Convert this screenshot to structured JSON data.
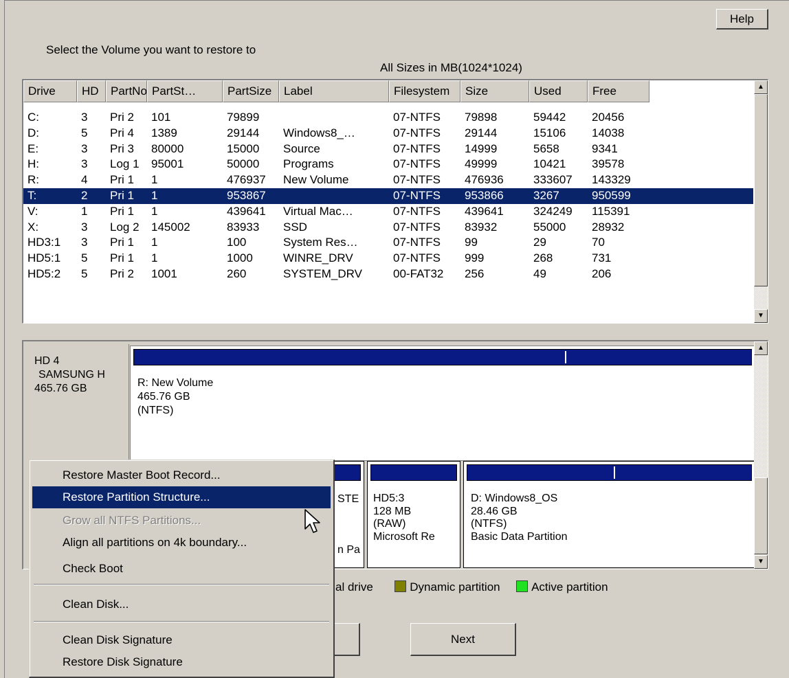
{
  "help_button": "Help",
  "instruction": "Select the Volume you want to restore to",
  "sizes_note": "All Sizes in MB(1024*1024)",
  "columns": [
    "Drive",
    "HD",
    "PartNo",
    "PartSt…",
    "PartSize",
    "Label",
    "Filesystem",
    "Size",
    "Used",
    "Free"
  ],
  "rows": [
    [
      "C:",
      "3",
      "Pri 2",
      "101",
      "79899",
      "",
      "07-NTFS",
      "79898",
      "59442",
      "20456"
    ],
    [
      "D:",
      "5",
      "Pri 4",
      "1389",
      "29144",
      "Windows8_…",
      "07-NTFS",
      "29144",
      "15106",
      "14038"
    ],
    [
      "E:",
      "3",
      "Pri 3",
      "80000",
      "15000",
      "Source",
      "07-NTFS",
      "14999",
      "5658",
      "9341"
    ],
    [
      "H:",
      "3",
      "Log 1",
      "95001",
      "50000",
      "Programs",
      "07-NTFS",
      "49999",
      "10421",
      "39578"
    ],
    [
      "R:",
      "4",
      "Pri 1",
      "1",
      "476937",
      "New Volume",
      "07-NTFS",
      "476936",
      "333607",
      "143329"
    ],
    [
      "T:",
      "2",
      "Pri 1",
      "1",
      "953867",
      "",
      "07-NTFS",
      "953866",
      "3267",
      "950599"
    ],
    [
      "V:",
      "1",
      "Pri 1",
      "1",
      "439641",
      "Virtual Mac…",
      "07-NTFS",
      "439641",
      "324249",
      "115391"
    ],
    [
      "X:",
      "3",
      "Log 2",
      "145002",
      "83933",
      "SSD",
      "07-NTFS",
      "83932",
      "55000",
      "28932"
    ],
    [
      "HD3:1",
      "3",
      "Pri 1",
      "1",
      "100",
      "System Res…",
      "07-NTFS",
      "99",
      "29",
      "70"
    ],
    [
      "HD5:1",
      "5",
      "Pri 1",
      "1",
      "1000",
      "WINRE_DRV",
      "07-NTFS",
      "999",
      "268",
      "731"
    ],
    [
      "HD5:2",
      "5",
      "Pri 2",
      "1001",
      "260",
      "SYSTEM_DRV",
      "00-FAT32",
      "256",
      "49",
      "206"
    ]
  ],
  "selected_row": 5,
  "disk_hd4": {
    "name": "HD 4",
    "model": "SAMSUNG H",
    "size": "465.76 GB",
    "partition": {
      "title": "R: New Volume",
      "size": "465.76 GB",
      "fs": "(NTFS)",
      "used_fraction": 0.7
    }
  },
  "disk_hd5": {
    "partial_a": {
      "line1": "STE",
      "line4": "n Pa"
    },
    "part_hd5_3": {
      "title": "HD5:3",
      "size": "128 MB",
      "fs": "(RAW)",
      "type": "Microsoft Re"
    },
    "part_d": {
      "title": "D: Windows8_OS",
      "size": "28.46 GB",
      "fs": "(NTFS)",
      "type": "Basic Data Partition",
      "used_fraction": 0.52
    }
  },
  "legend": {
    "logical_drive": "al drive",
    "dynamic_partition": "Dynamic partition",
    "active_partition": "Active partition",
    "dynamic_color": "#808000",
    "active_color": "#22e022"
  },
  "buttons": {
    "next": "Next"
  },
  "context_menu": {
    "items": [
      {
        "label": "Restore Master Boot Record...",
        "state": "normal"
      },
      {
        "label": "Restore Partition Structure...",
        "state": "highlighted"
      },
      {
        "label": "Grow all NTFS Partitions...",
        "state": "disabled"
      },
      {
        "label": "Align all partitions on 4k boundary...",
        "state": "normal"
      },
      {
        "label": "Check Boot",
        "state": "normal"
      },
      {
        "label": "Clean Disk...",
        "state": "normal"
      },
      {
        "label": "Clean Disk Signature",
        "state": "normal"
      },
      {
        "label": "Restore Disk Signature",
        "state": "normal"
      }
    ]
  },
  "colors": {
    "selection": "#0a246a",
    "partition_bar": "#0a1a84",
    "window_bg": "#d4d0c8"
  }
}
